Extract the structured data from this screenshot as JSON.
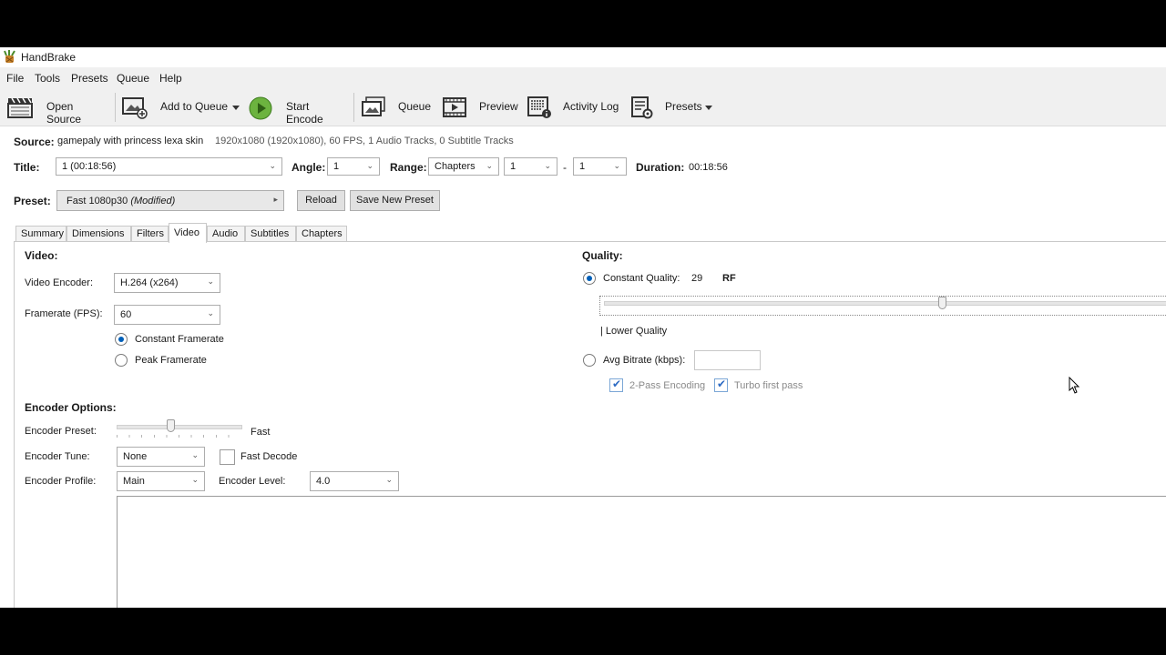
{
  "window": {
    "title": "HandBrake"
  },
  "menu": [
    "File",
    "Tools",
    "Presets",
    "Queue",
    "Help"
  ],
  "toolbar": {
    "open_source": "Open Source",
    "add_to_queue": "Add to Queue",
    "start_encode": "Start Encode",
    "queue": "Queue",
    "preview": "Preview",
    "activity_log": "Activity Log",
    "presets": "Presets"
  },
  "source": {
    "label": "Source:",
    "name": "gamepaly with princess lexa skin",
    "info": "1920x1080 (1920x1080), 60 FPS, 1 Audio Tracks, 0 Subtitle Tracks"
  },
  "title_row": {
    "title_label": "Title:",
    "title_value": "1  (00:18:56)",
    "angle_label": "Angle:",
    "angle_value": "1",
    "range_label": "Range:",
    "range_type": "Chapters",
    "range_start": "1",
    "range_dash": "-",
    "range_end": "1",
    "duration_label": "Duration:",
    "duration_value": "00:18:56"
  },
  "preset": {
    "label": "Preset:",
    "name": "Fast 1080p30",
    "modified": "(Modified)",
    "reload": "Reload",
    "save_new": "Save New Preset"
  },
  "tabs": [
    "Summary",
    "Dimensions",
    "Filters",
    "Video",
    "Audio",
    "Subtitles",
    "Chapters"
  ],
  "active_tab": "Video",
  "video": {
    "heading": "Video:",
    "encoder_label": "Video Encoder:",
    "encoder_value": "H.264 (x264)",
    "framerate_label": "Framerate (FPS):",
    "framerate_value": "60",
    "constant_framerate": "Constant Framerate",
    "peak_framerate": "Peak Framerate"
  },
  "quality": {
    "heading": "Quality:",
    "constant_quality_label": "Constant Quality:",
    "cq_value": "29",
    "cq_unit": "RF",
    "rf_slider_fraction": 0.6,
    "lower_quality": "| Lower Quality",
    "avg_bitrate_label": "Avg Bitrate (kbps):",
    "avg_bitrate_value": "",
    "two_pass": "2-Pass Encoding",
    "turbo": "Turbo first pass"
  },
  "encoder_options": {
    "heading": "Encoder Options:",
    "preset_label": "Encoder Preset:",
    "preset_value": "Fast",
    "preset_slider_fraction": 0.44,
    "tune_label": "Encoder Tune:",
    "tune_value": "None",
    "fast_decode": "Fast Decode",
    "profile_label": "Encoder Profile:",
    "profile_value": "Main",
    "level_label": "Encoder Level:",
    "level_value": "4.0"
  }
}
